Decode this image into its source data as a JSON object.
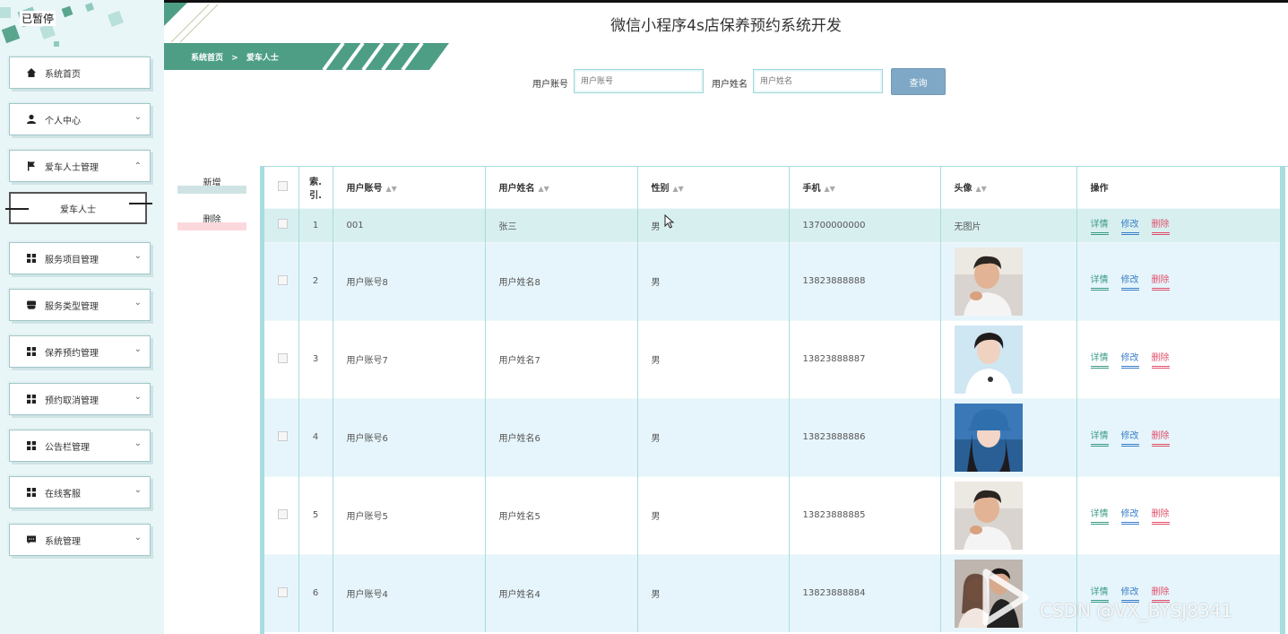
{
  "app": {
    "title": "微信小程序4s店保养预约系统开发",
    "logo_text": "已暂停"
  },
  "breadcrumb": {
    "home": "系统首页",
    "separator": ">",
    "current": "爱车人士"
  },
  "sidebar": {
    "items": [
      {
        "label": "系统首页",
        "icon": "home-icon",
        "has_chevron": false
      },
      {
        "label": "个人中心",
        "icon": "user-icon",
        "has_chevron": true
      },
      {
        "label": "爱车人士管理",
        "icon": "flag-icon",
        "has_chevron": true,
        "expanded": true
      },
      {
        "label": "服务项目管理",
        "icon": "grid-icon",
        "has_chevron": true
      },
      {
        "label": "服务类型管理",
        "icon": "store-icon",
        "has_chevron": true
      },
      {
        "label": "保养预约管理",
        "icon": "grid-icon",
        "has_chevron": true
      },
      {
        "label": "预约取消管理",
        "icon": "grid-icon",
        "has_chevron": true
      },
      {
        "label": "公告栏管理",
        "icon": "grid-icon",
        "has_chevron": true
      },
      {
        "label": "在线客服",
        "icon": "grid-icon",
        "has_chevron": true
      },
      {
        "label": "系统管理",
        "icon": "chat-icon",
        "has_chevron": true
      }
    ],
    "submenu": {
      "label": "爱车人士"
    }
  },
  "search": {
    "account_label": "用户账号",
    "account_placeholder": "用户账号",
    "name_label": "用户姓名",
    "name_placeholder": "用户姓名",
    "button": "查询"
  },
  "actions": {
    "add": "新增",
    "delete": "删除"
  },
  "table": {
    "headers": {
      "index_top": "索.",
      "index_bottom": "引.",
      "account": "用户账号",
      "name": "用户姓名",
      "gender": "性别",
      "phone": "手机",
      "avatar": "头像",
      "ops": "操作"
    },
    "ops": {
      "detail": "详情",
      "edit": "修改",
      "delete": "删除"
    },
    "rows": [
      {
        "index": "1",
        "account": "001",
        "name": "张三",
        "gender": "男",
        "phone": "13700000000",
        "avatar": "无图片"
      },
      {
        "index": "2",
        "account": "用户账号8",
        "name": "用户姓名8",
        "gender": "男",
        "phone": "13823888888",
        "avatar": "photo"
      },
      {
        "index": "3",
        "account": "用户账号7",
        "name": "用户姓名7",
        "gender": "男",
        "phone": "13823888887",
        "avatar": "photo"
      },
      {
        "index": "4",
        "account": "用户账号6",
        "name": "用户姓名6",
        "gender": "男",
        "phone": "13823888886",
        "avatar": "photo"
      },
      {
        "index": "5",
        "account": "用户账号5",
        "name": "用户姓名5",
        "gender": "男",
        "phone": "13823888885",
        "avatar": "photo"
      },
      {
        "index": "6",
        "account": "用户账号4",
        "name": "用户姓名4",
        "gender": "男",
        "phone": "13823888884",
        "avatar": "photo"
      }
    ]
  },
  "watermark": {
    "text": "CSDN @VX_BYSJ8341"
  },
  "colors": {
    "accent": "#4e9e86",
    "sidebar_bg": "#e9f6f8",
    "table_border": "#a8dcdf",
    "detail": "#3a9a86",
    "edit": "#3a7fc9",
    "delete": "#e04f6a",
    "search_button": "#7fa8c6"
  }
}
